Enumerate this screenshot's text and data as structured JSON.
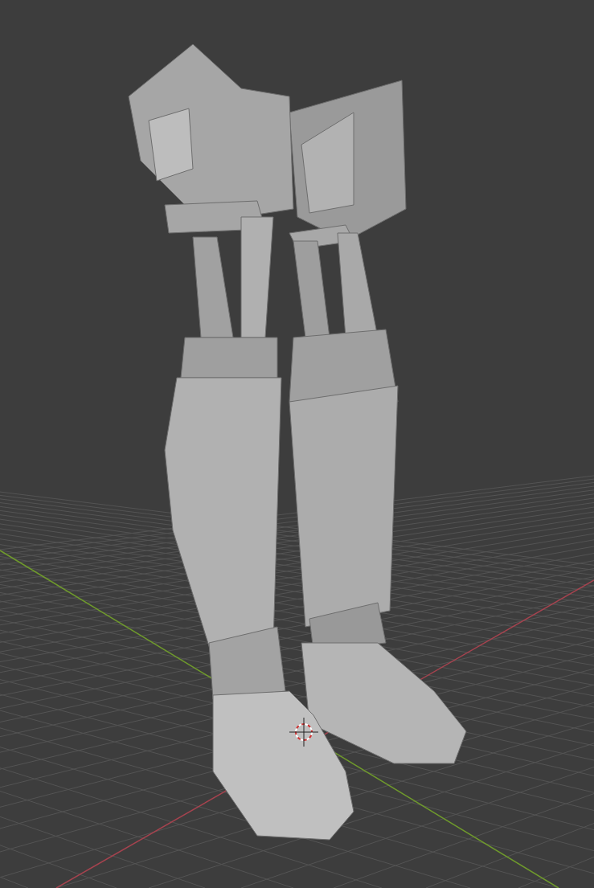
{
  "viewport": {
    "grid": true,
    "axes": true,
    "cursor": true,
    "model": true
  }
}
